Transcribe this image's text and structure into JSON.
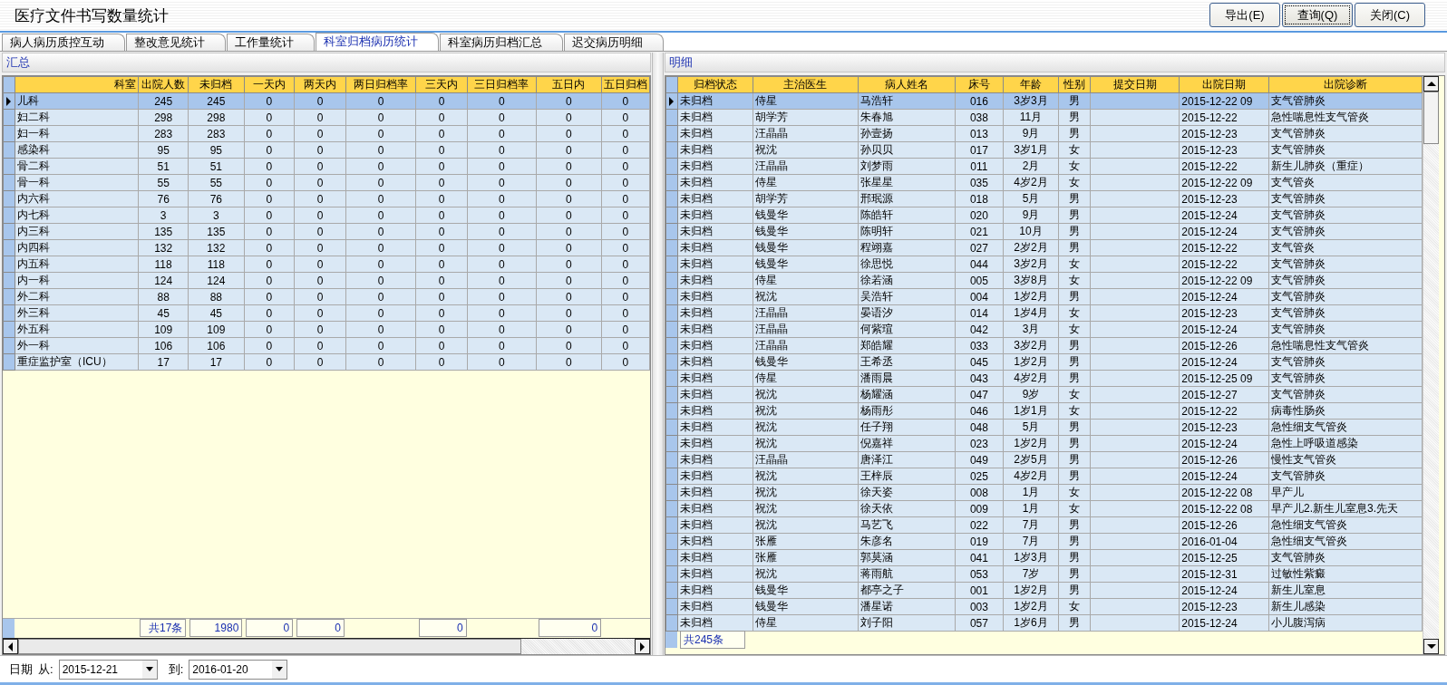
{
  "window": {
    "title": "医疗文件书写数量统计"
  },
  "toolbar_buttons": [
    {
      "label": "导出(E)",
      "focused": false
    },
    {
      "label": "查询(Q)",
      "focused": true
    },
    {
      "label": "关闭(C)",
      "focused": false
    }
  ],
  "tabs": [
    {
      "label": "病人病历质控互动",
      "selected": false
    },
    {
      "label": "整改意见统计",
      "selected": false
    },
    {
      "label": "工作量统计",
      "selected": false
    },
    {
      "label": "科室归档病历统计",
      "selected": true
    },
    {
      "label": "科室病历归档汇总",
      "selected": false
    },
    {
      "label": "迟交病历明细",
      "selected": false
    }
  ],
  "summary_panel": {
    "title": "汇总",
    "columns": [
      "科室",
      "出院人数",
      "未归档",
      "一天内",
      "两天内",
      "两日归档率",
      "三天内",
      "三日归档率",
      "五日内",
      "五日归档"
    ],
    "rows": [
      {
        "selected": true,
        "cells": [
          "儿科",
          "245",
          "245",
          "0",
          "0",
          "0",
          "0",
          "0",
          "0",
          "0"
        ]
      },
      {
        "selected": false,
        "cells": [
          "妇二科",
          "298",
          "298",
          "0",
          "0",
          "0",
          "0",
          "0",
          "0",
          "0"
        ]
      },
      {
        "selected": false,
        "cells": [
          "妇一科",
          "283",
          "283",
          "0",
          "0",
          "0",
          "0",
          "0",
          "0",
          "0"
        ]
      },
      {
        "selected": false,
        "cells": [
          "感染科",
          "95",
          "95",
          "0",
          "0",
          "0",
          "0",
          "0",
          "0",
          "0"
        ]
      },
      {
        "selected": false,
        "cells": [
          "骨二科",
          "51",
          "51",
          "0",
          "0",
          "0",
          "0",
          "0",
          "0",
          "0"
        ]
      },
      {
        "selected": false,
        "cells": [
          "骨一科",
          "55",
          "55",
          "0",
          "0",
          "0",
          "0",
          "0",
          "0",
          "0"
        ]
      },
      {
        "selected": false,
        "cells": [
          "内六科",
          "76",
          "76",
          "0",
          "0",
          "0",
          "0",
          "0",
          "0",
          "0"
        ]
      },
      {
        "selected": false,
        "cells": [
          "内七科",
          "3",
          "3",
          "0",
          "0",
          "0",
          "0",
          "0",
          "0",
          "0"
        ]
      },
      {
        "selected": false,
        "cells": [
          "内三科",
          "135",
          "135",
          "0",
          "0",
          "0",
          "0",
          "0",
          "0",
          "0"
        ]
      },
      {
        "selected": false,
        "cells": [
          "内四科",
          "132",
          "132",
          "0",
          "0",
          "0",
          "0",
          "0",
          "0",
          "0"
        ]
      },
      {
        "selected": false,
        "cells": [
          "内五科",
          "118",
          "118",
          "0",
          "0",
          "0",
          "0",
          "0",
          "0",
          "0"
        ]
      },
      {
        "selected": false,
        "cells": [
          "内一科",
          "124",
          "124",
          "0",
          "0",
          "0",
          "0",
          "0",
          "0",
          "0"
        ]
      },
      {
        "selected": false,
        "cells": [
          "外二科",
          "88",
          "88",
          "0",
          "0",
          "0",
          "0",
          "0",
          "0",
          "0"
        ]
      },
      {
        "selected": false,
        "cells": [
          "外三科",
          "45",
          "45",
          "0",
          "0",
          "0",
          "0",
          "0",
          "0",
          "0"
        ]
      },
      {
        "selected": false,
        "cells": [
          "外五科",
          "109",
          "109",
          "0",
          "0",
          "0",
          "0",
          "0",
          "0",
          "0"
        ]
      },
      {
        "selected": false,
        "cells": [
          "外一科",
          "106",
          "106",
          "0",
          "0",
          "0",
          "0",
          "0",
          "0",
          "0"
        ]
      },
      {
        "selected": false,
        "cells": [
          "重症监护室（ICU）",
          "17",
          "17",
          "0",
          "0",
          "0",
          "0",
          "0",
          "0",
          "0"
        ]
      }
    ],
    "totals": [
      {
        "kind": "gap"
      },
      {
        "kind": "box",
        "text": "共17条"
      },
      {
        "kind": "box",
        "text": "1980"
      },
      {
        "kind": "box",
        "text": "0"
      },
      {
        "kind": "box",
        "text": "0"
      },
      {
        "kind": "gap"
      },
      {
        "kind": "box",
        "text": "0"
      },
      {
        "kind": "gap"
      },
      {
        "kind": "box",
        "text": "0"
      },
      {
        "kind": "gap"
      }
    ]
  },
  "detail_panel": {
    "title": "明细",
    "columns": [
      "归档状态",
      "主治医生",
      "病人姓名",
      "床号",
      "年龄",
      "性别",
      "提交日期",
      "出院日期",
      "出院诊断"
    ],
    "rows": [
      {
        "selected": true,
        "status": "未归档",
        "doctor": "侍星",
        "patient": "马浩轩",
        "bed": "016",
        "age": "3岁3月",
        "sex": "男",
        "discharge_date": "2015-12-22 09",
        "diagnosis": "支气管肺炎"
      },
      {
        "selected": false,
        "status": "未归档",
        "doctor": "胡学芳",
        "patient": "朱春旭",
        "bed": "038",
        "age": "11月",
        "sex": "男",
        "discharge_date": "2015-12-22",
        "diagnosis": "急性喘息性支气管炎"
      },
      {
        "selected": false,
        "status": "未归档",
        "doctor": "汪晶晶",
        "patient": "孙壹扬",
        "bed": "013",
        "age": "9月",
        "sex": "男",
        "discharge_date": "2015-12-23",
        "diagnosis": "支气管肺炎"
      },
      {
        "selected": false,
        "status": "未归档",
        "doctor": "祝沈",
        "patient": "孙贝贝",
        "bed": "017",
        "age": "3岁1月",
        "sex": "女",
        "discharge_date": "2015-12-23",
        "diagnosis": "支气管肺炎"
      },
      {
        "selected": false,
        "status": "未归档",
        "doctor": "汪晶晶",
        "patient": "刘梦雨",
        "bed": "011",
        "age": "2月",
        "sex": "女",
        "discharge_date": "2015-12-22",
        "diagnosis": "新生儿肺炎（重症）"
      },
      {
        "selected": false,
        "status": "未归档",
        "doctor": "侍星",
        "patient": "张星星",
        "bed": "035",
        "age": "4岁2月",
        "sex": "女",
        "discharge_date": "2015-12-22 09",
        "diagnosis": "支气管炎"
      },
      {
        "selected": false,
        "status": "未归档",
        "doctor": "胡学芳",
        "patient": "邢珉源",
        "bed": "018",
        "age": "5月",
        "sex": "男",
        "discharge_date": "2015-12-23",
        "diagnosis": "支气管肺炎"
      },
      {
        "selected": false,
        "status": "未归档",
        "doctor": "钱曼华",
        "patient": "陈皓轩",
        "bed": "020",
        "age": "9月",
        "sex": "男",
        "discharge_date": "2015-12-24",
        "diagnosis": "支气管肺炎"
      },
      {
        "selected": false,
        "status": "未归档",
        "doctor": "钱曼华",
        "patient": "陈明轩",
        "bed": "021",
        "age": "10月",
        "sex": "男",
        "discharge_date": "2015-12-24",
        "diagnosis": "支气管肺炎"
      },
      {
        "selected": false,
        "status": "未归档",
        "doctor": "钱曼华",
        "patient": "程翊嘉",
        "bed": "027",
        "age": "2岁2月",
        "sex": "男",
        "discharge_date": "2015-12-22",
        "diagnosis": "支气管炎"
      },
      {
        "selected": false,
        "status": "未归档",
        "doctor": "钱曼华",
        "patient": "徐思悦",
        "bed": "044",
        "age": "3岁2月",
        "sex": "女",
        "discharge_date": "2015-12-22",
        "diagnosis": "支气管肺炎"
      },
      {
        "selected": false,
        "status": "未归档",
        "doctor": "侍星",
        "patient": "徐若涵",
        "bed": "005",
        "age": "3岁8月",
        "sex": "女",
        "discharge_date": "2015-12-22 09",
        "diagnosis": "支气管肺炎"
      },
      {
        "selected": false,
        "status": "未归档",
        "doctor": "祝沈",
        "patient": "吴浩轩",
        "bed": "004",
        "age": "1岁2月",
        "sex": "男",
        "discharge_date": "2015-12-24",
        "diagnosis": "支气管肺炎"
      },
      {
        "selected": false,
        "status": "未归档",
        "doctor": "汪晶晶",
        "patient": "晏语汐",
        "bed": "014",
        "age": "1岁4月",
        "sex": "女",
        "discharge_date": "2015-12-23",
        "diagnosis": "支气管肺炎"
      },
      {
        "selected": false,
        "status": "未归档",
        "doctor": "汪晶晶",
        "patient": "何紫瑄",
        "bed": "042",
        "age": "3月",
        "sex": "女",
        "discharge_date": "2015-12-24",
        "diagnosis": "支气管肺炎"
      },
      {
        "selected": false,
        "status": "未归档",
        "doctor": "汪晶晶",
        "patient": "郑皓耀",
        "bed": "033",
        "age": "3岁2月",
        "sex": "男",
        "discharge_date": "2015-12-26",
        "diagnosis": "急性喘息性支气管炎"
      },
      {
        "selected": false,
        "status": "未归档",
        "doctor": "钱曼华",
        "patient": "王希丞",
        "bed": "045",
        "age": "1岁2月",
        "sex": "男",
        "discharge_date": "2015-12-24",
        "diagnosis": "支气管肺炎"
      },
      {
        "selected": false,
        "status": "未归档",
        "doctor": "侍星",
        "patient": "潘雨晨",
        "bed": "043",
        "age": "4岁2月",
        "sex": "男",
        "discharge_date": "2015-12-25 09",
        "diagnosis": "支气管肺炎"
      },
      {
        "selected": false,
        "status": "未归档",
        "doctor": "祝沈",
        "patient": "杨耀涵",
        "bed": "047",
        "age": "9岁",
        "sex": "女",
        "discharge_date": "2015-12-27",
        "diagnosis": "支气管肺炎"
      },
      {
        "selected": false,
        "status": "未归档",
        "doctor": "祝沈",
        "patient": "杨雨彤",
        "bed": "046",
        "age": "1岁1月",
        "sex": "女",
        "discharge_date": "2015-12-22",
        "diagnosis": "病毒性肠炎"
      },
      {
        "selected": false,
        "status": "未归档",
        "doctor": "祝沈",
        "patient": "任子翔",
        "bed": "048",
        "age": "5月",
        "sex": "男",
        "discharge_date": "2015-12-23",
        "diagnosis": "急性细支气管炎"
      },
      {
        "selected": false,
        "status": "未归档",
        "doctor": "祝沈",
        "patient": "倪嘉祥",
        "bed": "023",
        "age": "1岁2月",
        "sex": "男",
        "discharge_date": "2015-12-24",
        "diagnosis": "急性上呼吸道感染"
      },
      {
        "selected": false,
        "status": "未归档",
        "doctor": "汪晶晶",
        "patient": "唐泽江",
        "bed": "049",
        "age": "2岁5月",
        "sex": "男",
        "discharge_date": "2015-12-26",
        "diagnosis": "慢性支气管炎"
      },
      {
        "selected": false,
        "status": "未归档",
        "doctor": "祝沈",
        "patient": "王梓辰",
        "bed": "025",
        "age": "4岁2月",
        "sex": "男",
        "discharge_date": "2015-12-24",
        "diagnosis": "支气管肺炎"
      },
      {
        "selected": false,
        "status": "未归档",
        "doctor": "祝沈",
        "patient": "徐天姿",
        "bed": "008",
        "age": "1月",
        "sex": "女",
        "discharge_date": "2015-12-22 08",
        "diagnosis": "早产儿"
      },
      {
        "selected": false,
        "status": "未归档",
        "doctor": "祝沈",
        "patient": "徐天依",
        "bed": "009",
        "age": "1月",
        "sex": "女",
        "discharge_date": "2015-12-22 08",
        "diagnosis": "早产儿2.新生儿室息3.先天"
      },
      {
        "selected": false,
        "status": "未归档",
        "doctor": "祝沈",
        "patient": "马艺飞",
        "bed": "022",
        "age": "7月",
        "sex": "男",
        "discharge_date": "2015-12-26",
        "diagnosis": "急性细支气管炎"
      },
      {
        "selected": false,
        "status": "未归档",
        "doctor": "张雁",
        "patient": "朱彦名",
        "bed": "019",
        "age": "7月",
        "sex": "男",
        "discharge_date": "2016-01-04",
        "diagnosis": "急性细支气管炎"
      },
      {
        "selected": false,
        "status": "未归档",
        "doctor": "张雁",
        "patient": "郭莫涵",
        "bed": "041",
        "age": "1岁3月",
        "sex": "男",
        "discharge_date": "2015-12-25",
        "diagnosis": "支气管肺炎"
      },
      {
        "selected": false,
        "status": "未归档",
        "doctor": "祝沈",
        "patient": "蒋雨航",
        "bed": "053",
        "age": "7岁",
        "sex": "男",
        "discharge_date": "2015-12-31",
        "diagnosis": "过敏性紫癜"
      },
      {
        "selected": false,
        "status": "未归档",
        "doctor": "钱曼华",
        "patient": "都亭之子",
        "bed": "001",
        "age": "1岁2月",
        "sex": "男",
        "discharge_date": "2015-12-24",
        "diagnosis": "新生儿室息"
      },
      {
        "selected": false,
        "status": "未归档",
        "doctor": "钱曼华",
        "patient": "潘星诺",
        "bed": "003",
        "age": "1岁2月",
        "sex": "女",
        "discharge_date": "2015-12-23",
        "diagnosis": "新生儿感染"
      },
      {
        "selected": false,
        "status": "未归档",
        "doctor": "侍星",
        "patient": "刘子阳",
        "bed": "057",
        "age": "1岁6月",
        "sex": "男",
        "discharge_date": "2015-12-24",
        "diagnosis": "小儿腹泻病"
      }
    ],
    "count": "共245条"
  },
  "date_filter": {
    "label": "日期",
    "from_label": "从:",
    "from": "2015-12-21",
    "to_label": "到:",
    "to": "2016-01-20"
  }
}
